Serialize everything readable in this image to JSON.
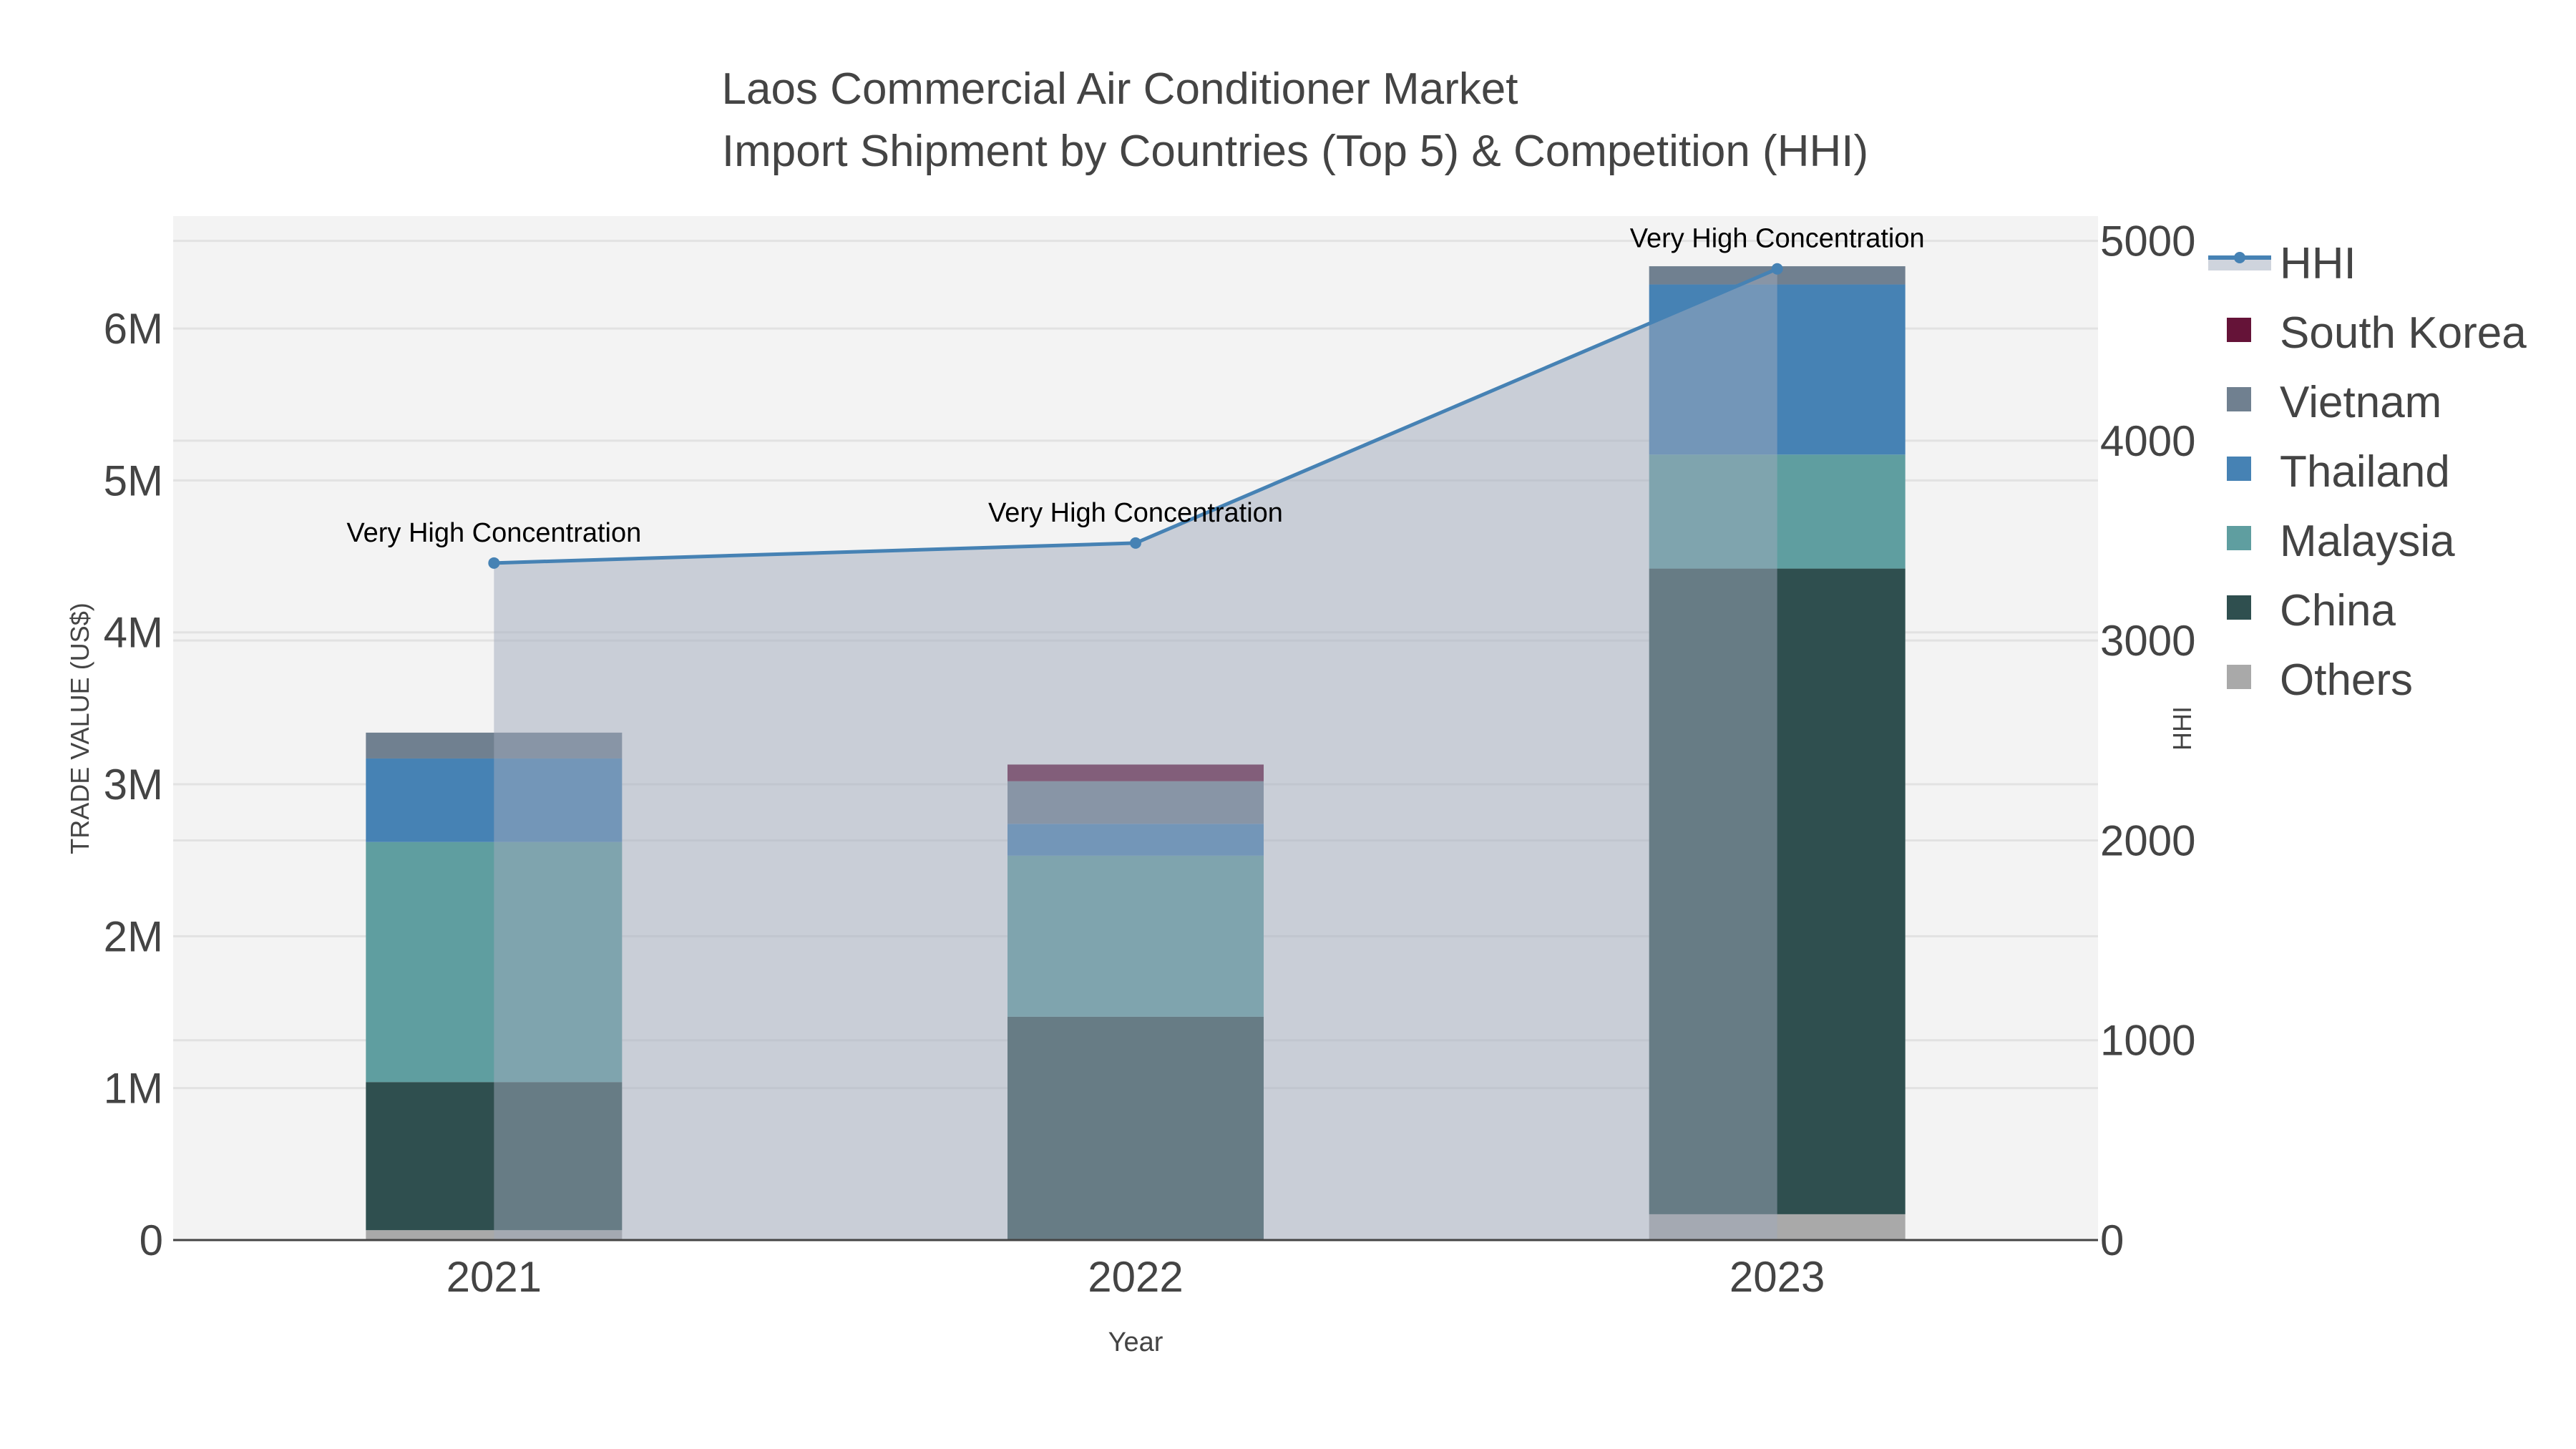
{
  "chart_data": {
    "type": "bar",
    "barmode": "stack",
    "title": "Laos Commercial Air Conditioner Market",
    "subtitle": "Import Shipment by Countries (Top 5) & Competition (HHI)",
    "xlabel": "Year",
    "ylabel": "TRADE VALUE (US$)",
    "y2label": "HHI",
    "categories": [
      "2021",
      "2022",
      "2023"
    ],
    "ylim": [
      0,
      6740000
    ],
    "y2lim": [
      0,
      5124
    ],
    "yticks": [
      0,
      1000000,
      2000000,
      3000000,
      4000000,
      5000000,
      6000000
    ],
    "ytick_labels": [
      "0",
      "1M",
      "2M",
      "3M",
      "4M",
      "5M",
      "6M"
    ],
    "y2ticks": [
      0,
      1000,
      2000,
      3000,
      4000,
      5000
    ],
    "y2tick_labels": [
      "0",
      "1000",
      "2000",
      "3000",
      "4000",
      "5000"
    ],
    "grid": true,
    "legend_position": "right",
    "series": [
      {
        "name": "Others",
        "color": "#a9a9a9",
        "values": [
          65000,
          0,
          170000
        ]
      },
      {
        "name": "China",
        "color": "#2f4f4f",
        "values": [
          975000,
          1470000,
          4250000
        ]
      },
      {
        "name": "Malaysia",
        "color": "#5f9ea0",
        "values": [
          1580000,
          1060000,
          750000
        ]
      },
      {
        "name": "Thailand",
        "color": "#4682b4",
        "values": [
          550000,
          210000,
          1120000
        ]
      },
      {
        "name": "Vietnam",
        "color": "#708090",
        "values": [
          170000,
          280000,
          120000
        ]
      },
      {
        "name": "South Korea",
        "color": "#651338",
        "values": [
          0,
          110000,
          0
        ]
      }
    ],
    "line": {
      "name": "HHI",
      "color": "#4682b4",
      "fill_color": "#a0aabb",
      "values": [
        3388,
        3488,
        4860
      ],
      "annotations": [
        "Very High Concentration",
        "Very High Concentration",
        "Very High Concentration"
      ]
    },
    "legend_order": [
      "HHI",
      "South Korea",
      "Vietnam",
      "Thailand",
      "Malaysia",
      "China",
      "Others"
    ]
  }
}
